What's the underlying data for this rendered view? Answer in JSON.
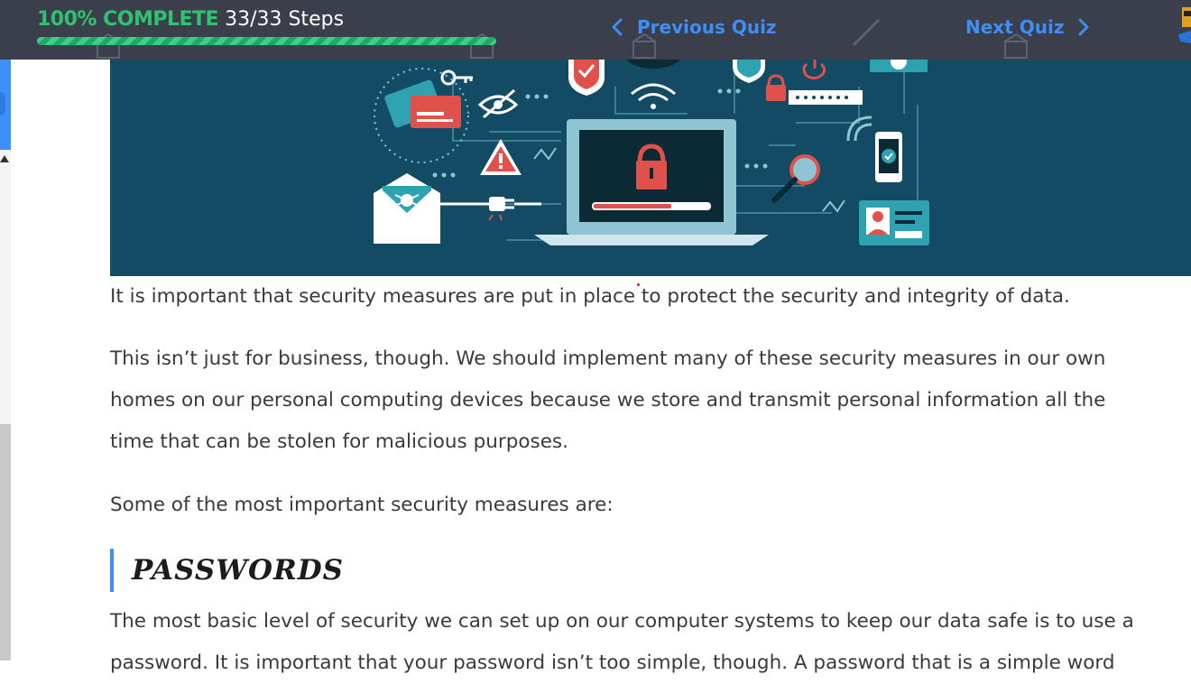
{
  "progress": {
    "percent_label": "100% COMPLETE",
    "steps_label": "33/33 Steps",
    "percent_value": 1.0
  },
  "nav": {
    "prev_label": "Previous Quiz",
    "next_label": "Next Quiz"
  },
  "colors": {
    "topbar": "#3b3f4c",
    "accent_green": "#2fc36f",
    "link_blue": "#3e8ef7",
    "hero_bg": "#124b63",
    "text": "#3a3a3a"
  },
  "icons": [
    "chevron-left-icon",
    "chevron-right-icon",
    "padlock-icon",
    "shield-icon",
    "credit-card-icon",
    "key-icon",
    "hidden-eye-icon",
    "warning-icon",
    "wifi-icon",
    "bug-mail-icon",
    "plug-icon",
    "magnifier-icon",
    "phone-check-icon",
    "id-card-icon",
    "password-field-icon"
  ],
  "content": {
    "paragraph_1": "It is important that security measures are put in place to protect the security and integrity of data.",
    "paragraph_2_lines": [
      "This isn’t just for business, though. We should implement many of these security measures in our own",
      "homes on our personal computing devices because we store and transmit personal information all the",
      "time that can be stolen for malicious purposes."
    ],
    "paragraph_3": "Some of the most important security measures are:",
    "heading": "PASSWORDS",
    "paragraph_4_lines": [
      "The most basic level of security we can set up on our computer systems to keep our data safe is to use a",
      "password. It is important that your password isn’t too simple, though. A password that is a simple word"
    ]
  }
}
